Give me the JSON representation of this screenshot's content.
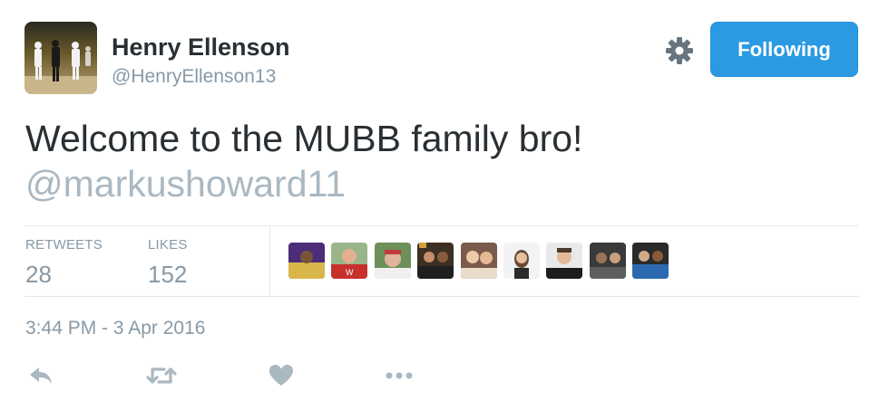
{
  "author": {
    "name": "Henry Ellenson",
    "handle": "@HenryEllenson13",
    "avatar_icon": "profile-photo-basketball-icon"
  },
  "header": {
    "settings_icon": "gear-icon",
    "follow_label": "Following",
    "follow_color": "#2b9ae3"
  },
  "tweet": {
    "text_line1": "Welcome to the MUBB family bro!",
    "mention": "@markushoward11"
  },
  "stats": {
    "retweets_label": "RETWEETS",
    "retweets_value": "28",
    "likes_label": "LIKES",
    "likes_value": "152"
  },
  "liked_by": [
    {
      "icon": "liker-avatar-icon"
    },
    {
      "icon": "liker-avatar-icon"
    },
    {
      "icon": "liker-avatar-icon"
    },
    {
      "icon": "liker-avatar-icon"
    },
    {
      "icon": "liker-avatar-icon"
    },
    {
      "icon": "liker-avatar-icon"
    },
    {
      "icon": "liker-avatar-icon"
    },
    {
      "icon": "liker-avatar-icon"
    },
    {
      "icon": "liker-avatar-icon"
    }
  ],
  "timestamp": "3:44 PM - 3 Apr 2016",
  "actions": [
    "reply-icon",
    "retweet-icon",
    "like-heart-icon",
    "more-dots-icon"
  ],
  "colors": {
    "text": "#292f33",
    "muted": "#8899a6",
    "mention": "#aab8c2",
    "divider": "#e1e8ed"
  }
}
